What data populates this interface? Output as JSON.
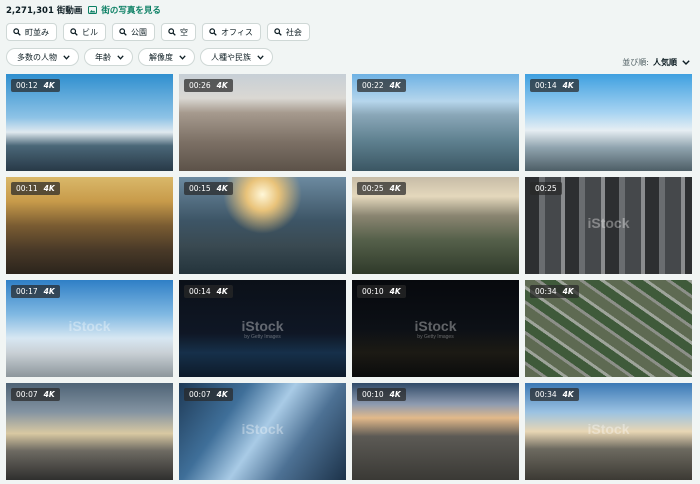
{
  "header": {
    "count": "2,271,301 街動画",
    "photo_link": "街の写真を見る"
  },
  "chips": [
    {
      "label": "町並み"
    },
    {
      "label": "ビル"
    },
    {
      "label": "公園"
    },
    {
      "label": "空"
    },
    {
      "label": "オフィス"
    },
    {
      "label": "社会"
    }
  ],
  "filters": [
    {
      "label": "多数の人物"
    },
    {
      "label": "年齢"
    },
    {
      "label": "解像度"
    },
    {
      "label": "人種や民族"
    }
  ],
  "sort": {
    "label": "並び順:",
    "value": "人気順"
  },
  "tiles": [
    {
      "duration": "00:12",
      "quality": "4K"
    },
    {
      "duration": "00:26",
      "quality": "4K"
    },
    {
      "duration": "00:22",
      "quality": "4K"
    },
    {
      "duration": "00:14",
      "quality": "4K"
    },
    {
      "duration": "00:11",
      "quality": "4K"
    },
    {
      "duration": "00:15",
      "quality": "4K"
    },
    {
      "duration": "00:25",
      "quality": "4K"
    },
    {
      "duration": "00:25",
      "quality": ""
    },
    {
      "duration": "00:17",
      "quality": "4K"
    },
    {
      "duration": "00:14",
      "quality": "4K"
    },
    {
      "duration": "00:10",
      "quality": "4K"
    },
    {
      "duration": "00:34",
      "quality": "4K"
    },
    {
      "duration": "00:07",
      "quality": "4K"
    },
    {
      "duration": "00:07",
      "quality": "4K"
    },
    {
      "duration": "00:10",
      "quality": "4K"
    },
    {
      "duration": "00:34",
      "quality": "4K"
    }
  ],
  "watermark": {
    "brand": "iStock",
    "sub": "by Getty Images"
  },
  "colors": {
    "accent": "#0a7f63",
    "background": "#f1f5f4"
  }
}
